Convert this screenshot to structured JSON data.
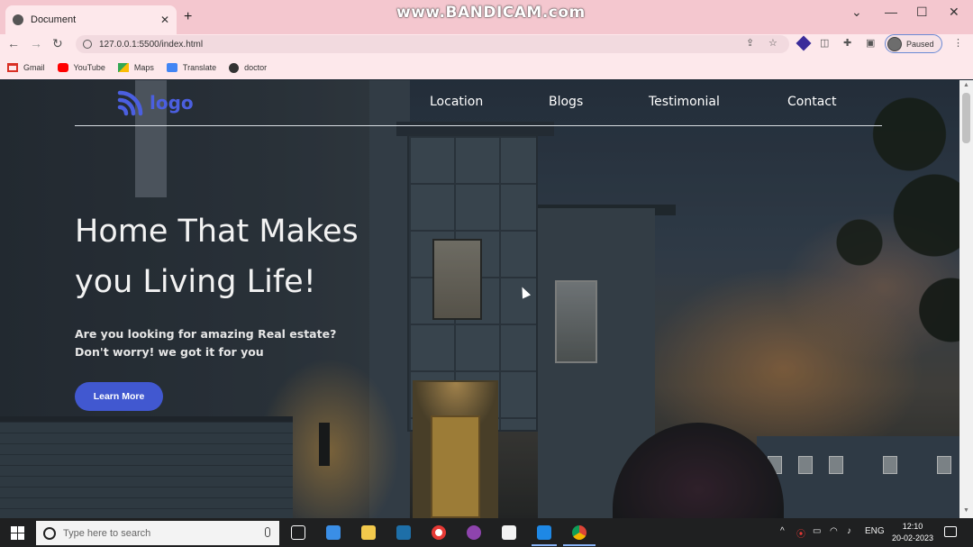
{
  "browser": {
    "tab_title": "Document",
    "watermark": "www.BANDICAM.com",
    "url": "127.0.0.1:5500/index.html",
    "profile_status": "Paused",
    "bookmarks": [
      {
        "label": "Gmail",
        "icon": "gmail-icon",
        "color": "#d93025"
      },
      {
        "label": "YouTube",
        "icon": "youtube-icon",
        "color": "#ff0000"
      },
      {
        "label": "Maps",
        "icon": "maps-icon",
        "color": "#34a853"
      },
      {
        "label": "Translate",
        "icon": "translate-icon",
        "color": "#4285f4"
      },
      {
        "label": "doctor",
        "icon": "globe-icon",
        "color": "#333333"
      }
    ]
  },
  "page": {
    "logo_text": "logo",
    "accent_color": "#4158d0",
    "nav": [
      "Location",
      "Blogs",
      "Testimonial",
      "Contact"
    ],
    "hero_title_line1": "Home That Makes",
    "hero_title_line2": "you Living Life!",
    "hero_sub_line1": "Are you looking for amazing Real estate?",
    "hero_sub_line2": "Don't worry! we got it for you",
    "cta_label": "Learn More"
  },
  "taskbar": {
    "search_placeholder": "Type here to search",
    "language": "ENG",
    "time": "12:10",
    "date": "20-02-2023"
  }
}
